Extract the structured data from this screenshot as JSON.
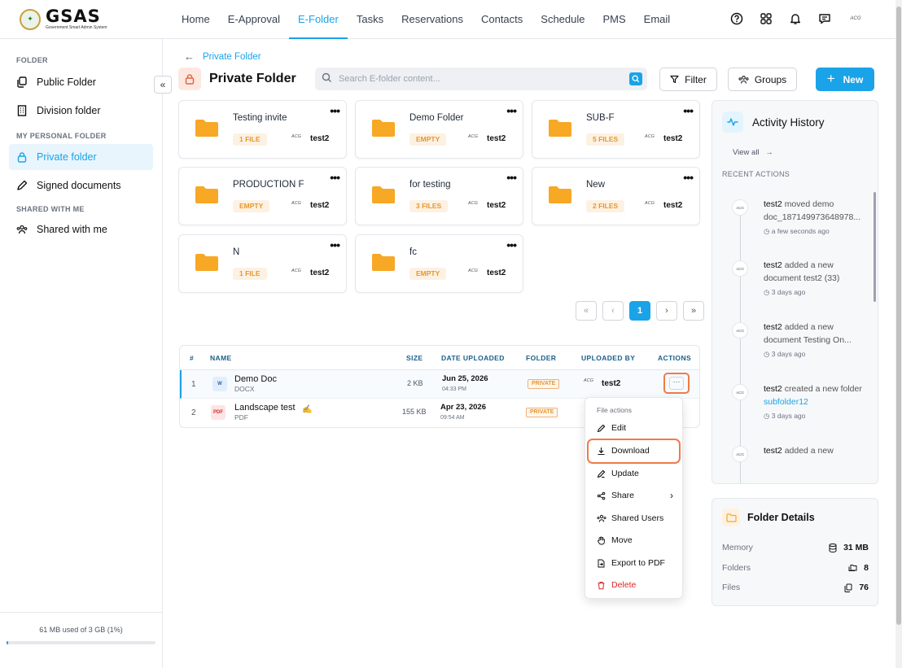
{
  "app": {
    "name": "GSAS",
    "subtitle": "Government Smart Admin System"
  },
  "nav": [
    {
      "label": "Home"
    },
    {
      "label": "E-Approval"
    },
    {
      "label": "E-Folder",
      "active": true
    },
    {
      "label": "Tasks"
    },
    {
      "label": "Reservations"
    },
    {
      "label": "Contacts"
    },
    {
      "label": "Schedule"
    },
    {
      "label": "PMS"
    },
    {
      "label": "Email"
    }
  ],
  "user": {
    "avatar_text": "ACG"
  },
  "sidebar": {
    "section_folder": "FOLDER",
    "public_folder": "Public Folder",
    "division_folder": "Division folder",
    "section_personal": "MY PERSONAL FOLDER",
    "private_folder": "Private folder",
    "signed_documents": "Signed documents",
    "section_shared": "SHARED WITH ME",
    "shared_with_me": "Shared with me",
    "storage_text": "61 MB used of 3 GB (1%)",
    "storage_percent": 1
  },
  "breadcrumb": "Private Folder",
  "page_title": "Private Folder",
  "search": {
    "placeholder": "Search E-folder content..."
  },
  "buttons": {
    "filter": "Filter",
    "groups": "Groups",
    "new": "New"
  },
  "folders": [
    {
      "name": "Testing invite",
      "badge": "1 FILE",
      "owner": "test2"
    },
    {
      "name": "Demo Folder",
      "badge": "EMPTY",
      "owner": "test2"
    },
    {
      "name": "SUB-F",
      "badge": "5 FILES",
      "owner": "test2"
    },
    {
      "name": "PRODUCTION F",
      "badge": "EMPTY",
      "owner": "test2"
    },
    {
      "name": "for testing",
      "badge": "3 FILES",
      "owner": "test2"
    },
    {
      "name": "New",
      "badge": "2 FILES",
      "owner": "test2"
    },
    {
      "name": "N",
      "badge": "1 FILE",
      "owner": "test2"
    },
    {
      "name": "fc",
      "badge": "EMPTY",
      "owner": "test2"
    }
  ],
  "pagination": {
    "current": "1"
  },
  "table": {
    "headers": {
      "num": "#",
      "name": "NAME",
      "size": "SIZE",
      "date": "DATE UPLOADED",
      "folder": "FOLDER",
      "uploader": "UPLOADED BY",
      "actions": "ACTIONS"
    },
    "rows": [
      {
        "num": "1",
        "name": "Demo Doc",
        "type": "DOCX",
        "size": "2 KB",
        "date": "Jun 25, 2026",
        "time": "04:33 PM",
        "folder": "PRIVATE",
        "uploader": "test2"
      },
      {
        "num": "2",
        "name": "Landscape test",
        "type": "PDF",
        "size": "155 KB",
        "date": "Apr 23, 2026",
        "time": "09:54 AM",
        "folder": "PRIVATE",
        "uploader": ""
      }
    ]
  },
  "file_menu": {
    "header": "File actions",
    "items": [
      "Edit",
      "Download",
      "Update",
      "Share",
      "Shared Users",
      "Move",
      "Export to PDF",
      "Delete"
    ]
  },
  "activity": {
    "title": "Activity History",
    "view_all": "View all",
    "recent_label": "RECENT ACTIONS",
    "items": [
      {
        "user": "test2",
        "text": "moved demo doc_187149973648978...",
        "link": "",
        "time": "a few seconds ago"
      },
      {
        "user": "test2",
        "text": "added a new document  test2 (33)",
        "link": "",
        "time": "3 days ago"
      },
      {
        "user": "test2",
        "text": "added a new document  Testing On...",
        "link": "",
        "time": "3 days ago"
      },
      {
        "user": "test2",
        "text": "created a new folder",
        "link": "subfolder12",
        "time": "3 days ago"
      },
      {
        "user": "test2",
        "text": "added a new",
        "link": "",
        "time": ""
      }
    ]
  },
  "details": {
    "title": "Folder Details",
    "memory_label": "Memory",
    "memory_value": "31 MB",
    "folders_label": "Folders",
    "folders_value": "8",
    "files_label": "Files",
    "files_value": "76"
  },
  "colors": {
    "accent": "#1aa3e8",
    "highlight": "#f07a4a",
    "folder": "#f7a825"
  }
}
